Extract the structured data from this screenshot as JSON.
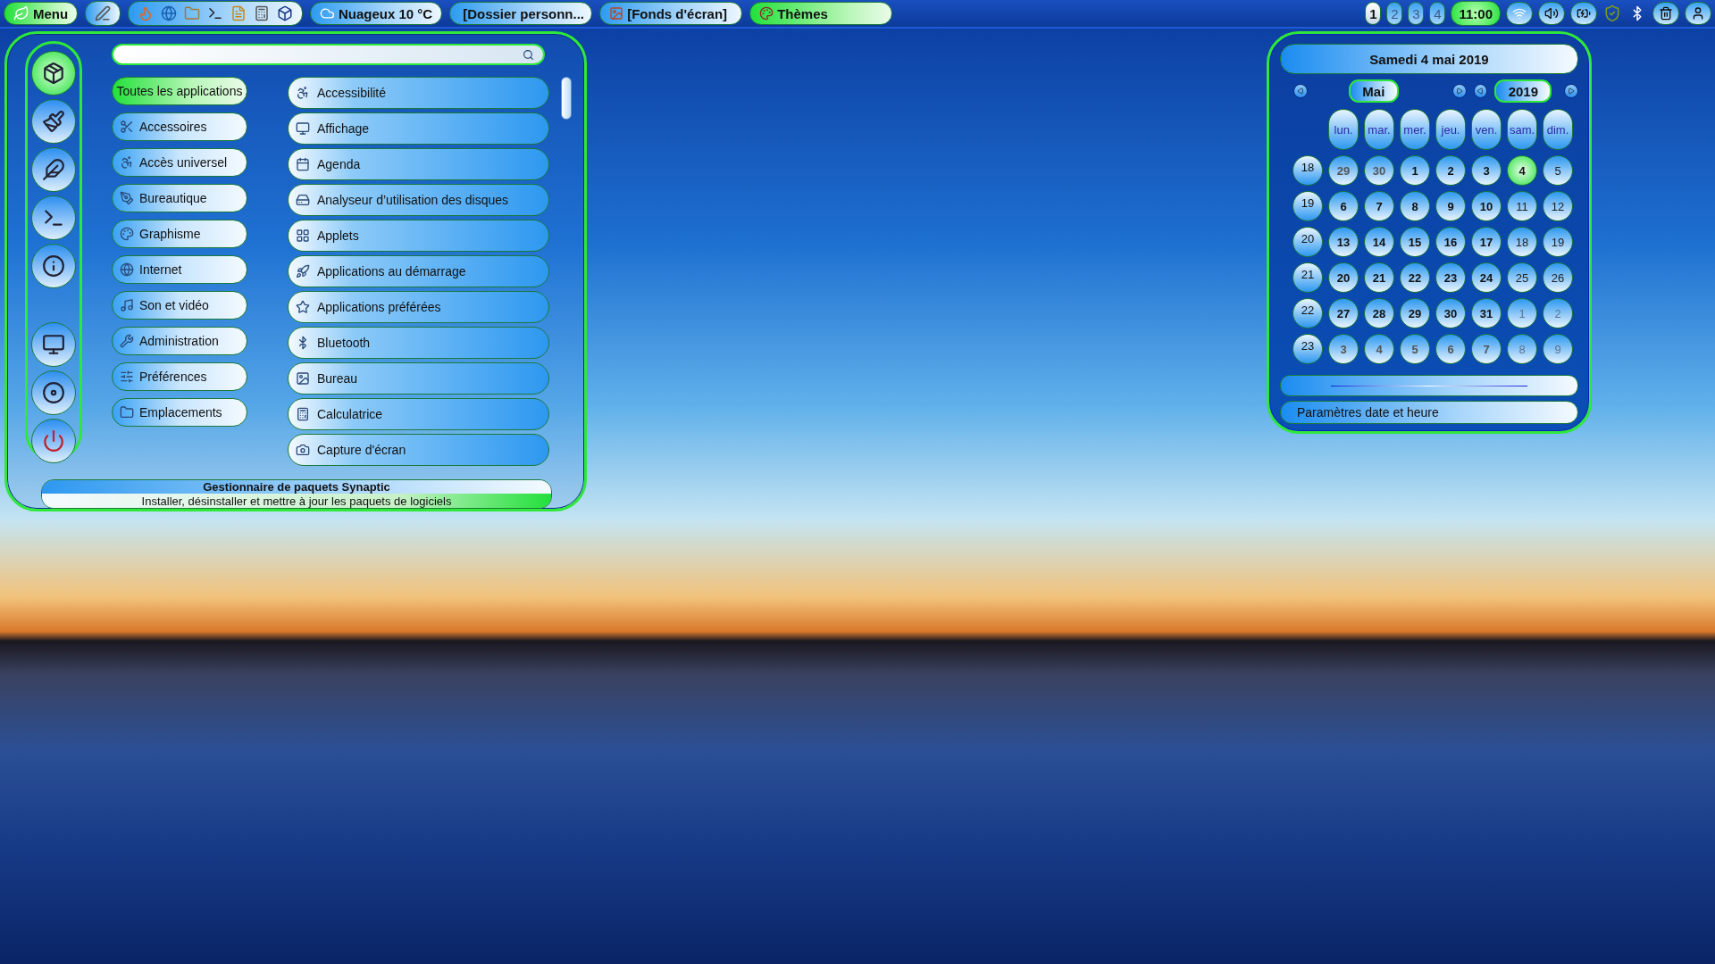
{
  "taskbar": {
    "menu_label": "Menu",
    "weather": "Nuageux 10 °C",
    "windows": [
      {
        "title": "[Dossier personn...",
        "selected": false
      },
      {
        "title": "[Fonds d'écran]",
        "selected": false
      },
      {
        "title": "Thèmes",
        "selected": true
      }
    ],
    "workspaces": [
      {
        "label": "1",
        "selected": true
      },
      {
        "label": "2",
        "selected": false
      },
      {
        "label": "3",
        "selected": false
      },
      {
        "label": "4",
        "selected": false
      }
    ],
    "clock": "11:00"
  },
  "menu": {
    "categories": [
      {
        "label": "Toutes les applications",
        "selected": true
      },
      {
        "label": "Accessoires",
        "selected": false
      },
      {
        "label": "Accès universel",
        "selected": false
      },
      {
        "label": "Bureautique",
        "selected": false
      },
      {
        "label": "Graphisme",
        "selected": false
      },
      {
        "label": "Internet",
        "selected": false
      },
      {
        "label": "Son et vidéo",
        "selected": false
      },
      {
        "label": "Administration",
        "selected": false
      },
      {
        "label": "Préférences",
        "selected": false
      },
      {
        "label": "Emplacements",
        "selected": false
      }
    ],
    "applications": [
      "Accessibilité",
      "Affichage",
      "Agenda",
      "Analyseur d’utilisation des disques",
      "Applets",
      "Applications au démarrage",
      "Applications préférées",
      "Bluetooth",
      "Bureau",
      "Calculatrice",
      "Capture d'écran"
    ],
    "status": {
      "title": "Gestionnaire de paquets Synaptic",
      "description": "Installer, désinstaller et mettre à jour les paquets de logiciels"
    }
  },
  "calendar": {
    "date_title": "Samedi 4 mai 2019",
    "month": "Mai",
    "year": "2019",
    "weekdays": [
      "lun.",
      "mar.",
      "mer.",
      "jeu.",
      "ven.",
      "sam.",
      "dim."
    ],
    "weeks": [
      {
        "number": "18",
        "days": [
          {
            "text": "29",
            "kind": "other",
            "selected": false
          },
          {
            "text": "30",
            "kind": "other",
            "selected": false
          },
          {
            "text": "1",
            "kind": "weekday",
            "selected": false
          },
          {
            "text": "2",
            "kind": "weekday",
            "selected": false
          },
          {
            "text": "3",
            "kind": "weekday",
            "selected": false
          },
          {
            "text": "4",
            "kind": "weekday",
            "selected": true
          },
          {
            "text": "5",
            "kind": "weekend",
            "selected": false
          }
        ]
      },
      {
        "number": "19",
        "days": [
          {
            "text": "6",
            "kind": "weekday",
            "selected": false
          },
          {
            "text": "7",
            "kind": "weekday",
            "selected": false
          },
          {
            "text": "8",
            "kind": "weekday",
            "selected": false
          },
          {
            "text": "9",
            "kind": "weekday",
            "selected": false
          },
          {
            "text": "10",
            "kind": "weekday",
            "selected": false
          },
          {
            "text": "11",
            "kind": "weekend",
            "selected": false
          },
          {
            "text": "12",
            "kind": "weekend",
            "selected": false
          }
        ]
      },
      {
        "number": "20",
        "days": [
          {
            "text": "13",
            "kind": "weekday",
            "selected": false
          },
          {
            "text": "14",
            "kind": "weekday",
            "selected": false
          },
          {
            "text": "15",
            "kind": "weekday",
            "selected": false
          },
          {
            "text": "16",
            "kind": "weekday",
            "selected": false
          },
          {
            "text": "17",
            "kind": "weekday",
            "selected": false
          },
          {
            "text": "18",
            "kind": "weekend",
            "selected": false
          },
          {
            "text": "19",
            "kind": "weekend",
            "selected": false
          }
        ]
      },
      {
        "number": "21",
        "days": [
          {
            "text": "20",
            "kind": "weekday",
            "selected": false
          },
          {
            "text": "21",
            "kind": "weekday",
            "selected": false
          },
          {
            "text": "22",
            "kind": "weekday",
            "selected": false
          },
          {
            "text": "23",
            "kind": "weekday",
            "selected": false
          },
          {
            "text": "24",
            "kind": "weekday",
            "selected": false
          },
          {
            "text": "25",
            "kind": "weekend",
            "selected": false
          },
          {
            "text": "26",
            "kind": "weekend",
            "selected": false
          }
        ]
      },
      {
        "number": "22",
        "days": [
          {
            "text": "27",
            "kind": "weekday",
            "selected": false
          },
          {
            "text": "28",
            "kind": "weekday",
            "selected": false
          },
          {
            "text": "29",
            "kind": "weekday",
            "selected": false
          },
          {
            "text": "30",
            "kind": "weekday",
            "selected": false
          },
          {
            "text": "31",
            "kind": "weekday",
            "selected": false
          },
          {
            "text": "1",
            "kind": "other-weekend",
            "selected": false
          },
          {
            "text": "2",
            "kind": "other-weekend",
            "selected": false
          }
        ]
      },
      {
        "number": "23",
        "days": [
          {
            "text": "3",
            "kind": "other",
            "selected": false
          },
          {
            "text": "4",
            "kind": "other",
            "selected": false
          },
          {
            "text": "5",
            "kind": "other",
            "selected": false
          },
          {
            "text": "6",
            "kind": "other",
            "selected": false
          },
          {
            "text": "7",
            "kind": "other",
            "selected": false
          },
          {
            "text": "8",
            "kind": "other-weekend",
            "selected": false
          },
          {
            "text": "9",
            "kind": "other-weekend",
            "selected": false
          }
        ]
      }
    ],
    "settings_button": "Paramètres date et heure"
  }
}
